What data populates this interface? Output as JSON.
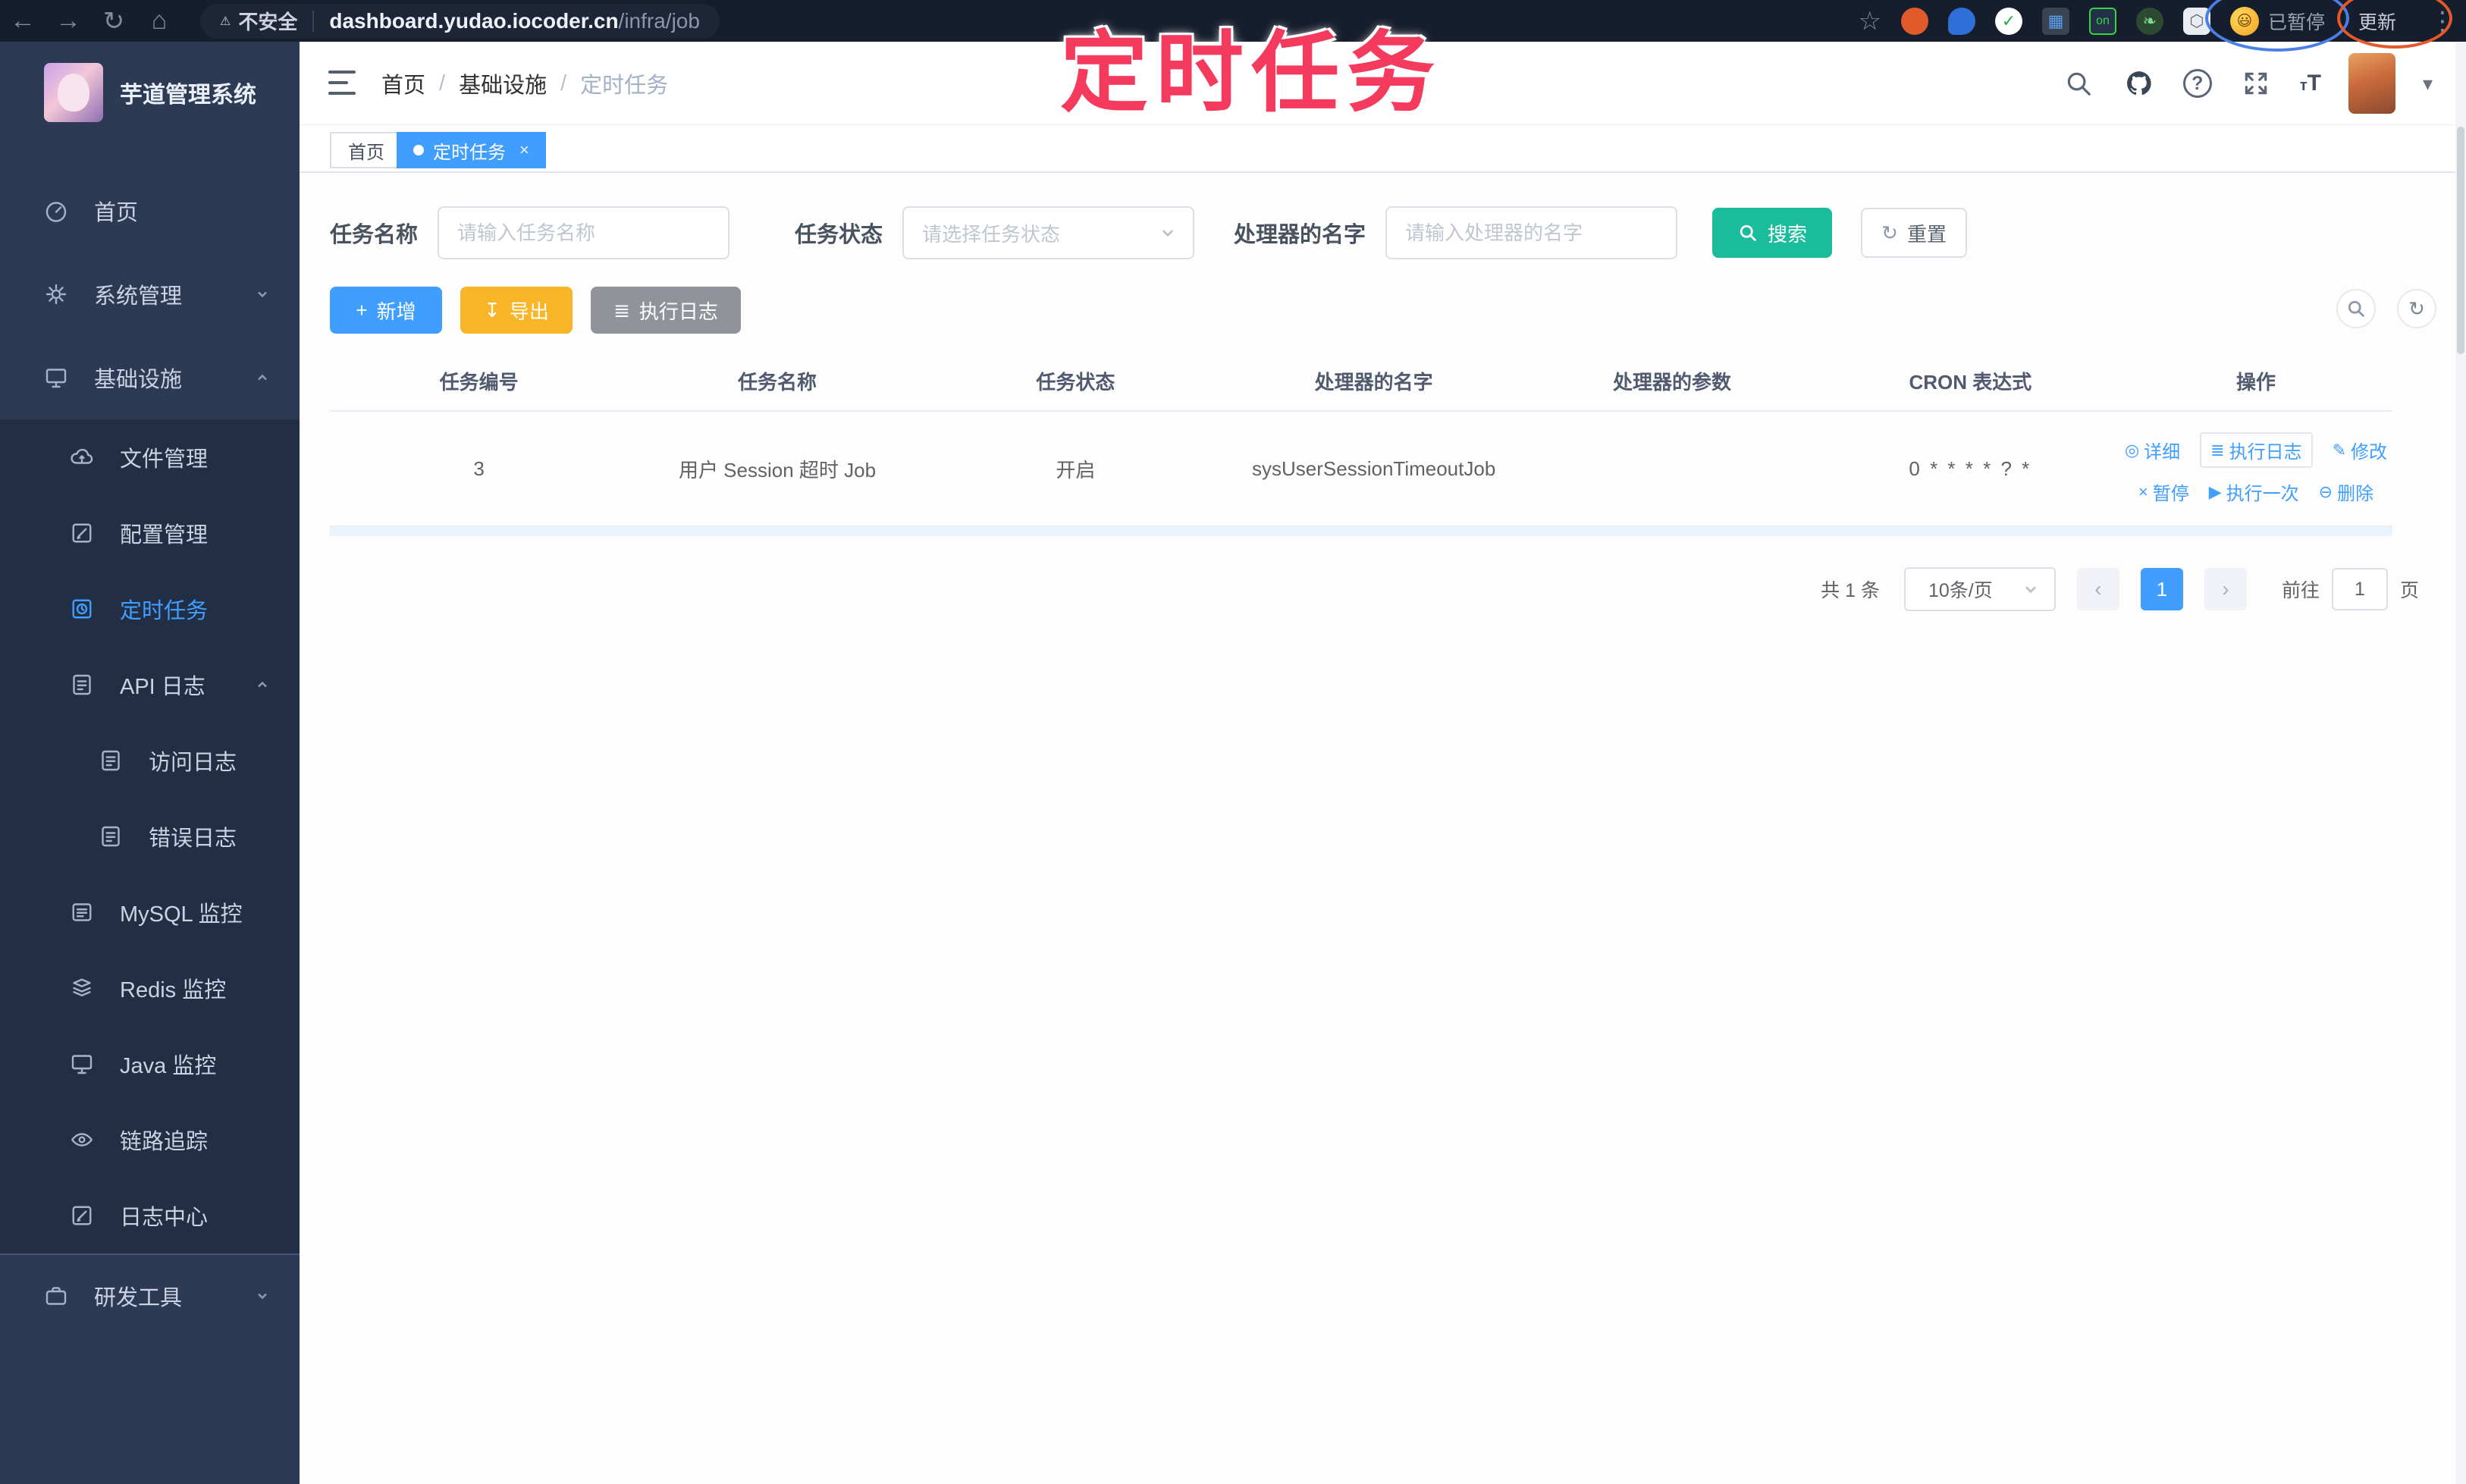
{
  "theme": {
    "accent": "#409eff",
    "teal": "#1abc9c",
    "warn": "#f8b527",
    "info": "#909399",
    "ann": "#f43b5e",
    "side": "#2c3a54",
    "sub": "#212e44",
    "chrome": "#161d2c",
    "link": "#409eff"
  },
  "icons": {
    "back": "←",
    "forward": "→",
    "reload": "↻",
    "home": "⌂",
    "warning": "⚠",
    "star": "☆",
    "kebab": "⋮",
    "caret": "▾",
    "plus": "+",
    "export": "↧",
    "list": "≣",
    "reset": "↻",
    "eye": "◎",
    "edit": "✎",
    "close": "×",
    "play": "▶",
    "delete": "⊖",
    "dot": "●",
    "tab_close": "×",
    "prev": "‹",
    "next": "›",
    "check": "✓",
    "on_badge": "on"
  },
  "browser": {
    "security_label": "不安全",
    "url_host": "dashboard.yudao.iocoder.cn",
    "url_path": "/infra/job",
    "profile_badge": "已暂停",
    "update_button": "更新",
    "emoji": "😃"
  },
  "annotation": {
    "title": "定时任务"
  },
  "sidebar": {
    "app_title": "芋道管理系统",
    "items": [
      {
        "label": "首页"
      },
      {
        "label": "系统管理"
      },
      {
        "label": "基础设施"
      },
      {
        "label": "文件管理"
      },
      {
        "label": "配置管理"
      },
      {
        "label": "定时任务"
      },
      {
        "label": "API 日志"
      },
      {
        "label": "访问日志"
      },
      {
        "label": "错误日志"
      },
      {
        "label": "MySQL 监控"
      },
      {
        "label": "Redis 监控"
      },
      {
        "label": "Java 监控"
      },
      {
        "label": "链路追踪"
      },
      {
        "label": "日志中心"
      },
      {
        "label": "研发工具"
      }
    ]
  },
  "header": {
    "breadcrumbs": {
      "b0": "首页",
      "b1": "基础设施",
      "b2": "定时任务"
    },
    "separator": "/",
    "font_icon": "tT"
  },
  "tabs": {
    "t0": "首页",
    "t1": "定时任务"
  },
  "filters": {
    "name_label": "任务名称",
    "name_placeholder": "请输入任务名称",
    "status_label": "任务状态",
    "status_placeholder": "请选择任务状态",
    "handler_label": "处理器的名字",
    "handler_placeholder": "请输入处理器的名字",
    "search_label": "搜索",
    "reset_label": "重置"
  },
  "toolbar": {
    "add_label": "新增",
    "export_label": "导出",
    "exec_log_label": "执行日志"
  },
  "table": {
    "columns": {
      "c0": "任务编号",
      "c1": "任务名称",
      "c2": "任务状态",
      "c3": "处理器的名字",
      "c4": "处理器的参数",
      "c5": "CRON 表达式",
      "c6": "操作"
    },
    "rows": [
      {
        "id": "3",
        "name": "用户 Session 超时 Job",
        "status": "开启",
        "handler": "sysUserSessionTimeoutJob",
        "param": "",
        "cron": "0 * * * * ? *"
      }
    ],
    "row_actions": {
      "a0": "详细",
      "a1": "执行日志",
      "a2": "修改",
      "a3": "暂停",
      "a4": "执行一次",
      "a5": "删除"
    }
  },
  "pagination": {
    "total": "共 1 条",
    "page_size": "10条/页",
    "page": "1",
    "goto_label": "前往",
    "page_unit": "页",
    "goto_value": "1"
  }
}
